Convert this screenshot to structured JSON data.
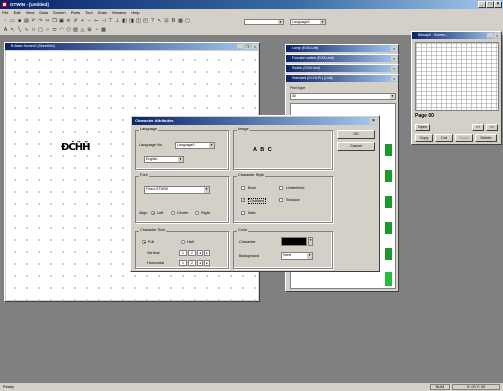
{
  "app": {
    "title": "GTWIN - [Untitled]"
  },
  "menu": [
    "File",
    "Edit",
    "View",
    "Data",
    "Screen",
    "Parts",
    "Tool",
    "Draw",
    "Window",
    "Help"
  ],
  "toolbar_dropdowns": {
    "combo1": "",
    "combo2": "Language0"
  },
  "screen_window": {
    "title": "B-Base Screen0 (Sheet0ed)"
  },
  "canvas_text": "ĐĆȞȞ",
  "parts_windows": [
    {
      "title": "Lamp (E00LUnit)"
    },
    {
      "title": "Function switch (E00LUnit)"
    },
    {
      "title": "Switch (E00LUnit)"
    },
    {
      "title": "Standard (ECOLPL) [Unit]"
    }
  ],
  "part_panel": {
    "label": "Part type",
    "value": "All"
  },
  "right_window": {
    "title": "Bitmap0 - Screen...",
    "page_label": "Page 00",
    "buttons": [
      "Open",
      "Copy",
      "Cut",
      "Paste",
      "Delete"
    ],
    "arrows": [
      "<<",
      ">>"
    ]
  },
  "dialog": {
    "title": "Character Attributes",
    "ok": "OK",
    "cancel": "Cancel",
    "language_group": "Language",
    "language_no_label": "Language No.",
    "language_no_value": "Language0",
    "language_value": "English",
    "image_group": "Image",
    "image_text": "A B C",
    "font_group": "Font",
    "font_value": "Fixed-GTW08",
    "align_label": "Align",
    "align_options": [
      "Left",
      "Center",
      "Right"
    ],
    "char_style_group": "Character Style",
    "styles": [
      "Bold",
      "Underlined",
      "Outlined",
      "Shadow",
      "Italic"
    ],
    "char_size_group": "Character Size",
    "size_options": [
      "Full",
      "Half"
    ],
    "vertical_label": "Vertical",
    "horizontal_label": "Horizontal",
    "vertical_value": "2",
    "horizontal_value": "2",
    "color_group": "Color",
    "character_label": "Character",
    "background_label": "Background",
    "background_value": "None"
  },
  "statusbar": {
    "left": "Ready",
    "right1": "NUM",
    "right2": "X: 00  Y: 00"
  }
}
